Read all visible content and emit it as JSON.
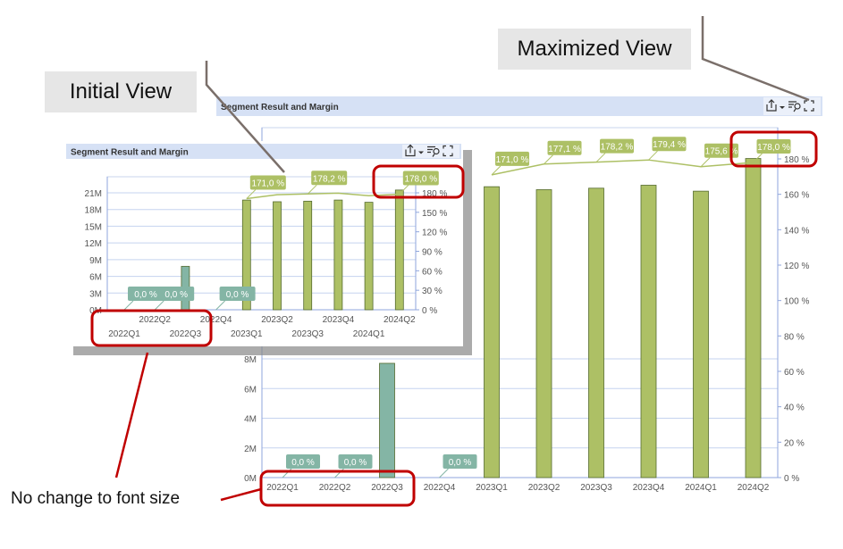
{
  "annotations": {
    "maximized_label": "Maximized View",
    "initial_label": "Initial View",
    "note": "No change to font size",
    "callout_color": "#e6e6e6",
    "highlight_color": "#c00000"
  },
  "panels": {
    "title": "Segment Result and Margin",
    "header_color": "#d6e1f5",
    "toolbar_icons": [
      "export-icon",
      "chevron-down-icon",
      "filter-search-icon",
      "maximize-icon"
    ],
    "maximized_toolbar_icons": [
      "export-icon",
      "chevron-down-icon",
      "filter-search-icon",
      "minimize-icon"
    ]
  },
  "chart_data": [
    {
      "name": "initial",
      "type": "bar",
      "title": "Segment Result and Margin",
      "categories": [
        "2022Q1",
        "2022Q2",
        "2022Q3",
        "2022Q4",
        "2023Q1",
        "2023Q2",
        "2023Q3",
        "2023Q4",
        "2024Q1",
        "2024Q2"
      ],
      "bar_values_M": [
        0,
        0,
        7.8,
        0,
        19.7,
        19.4,
        19.5,
        19.7,
        19.3,
        21.5
      ],
      "bar_colors": [
        "#84b5a5",
        "#84b5a5",
        "#84b5a5",
        "#84b5a5",
        "#adc065",
        "#adc065",
        "#adc065",
        "#adc065",
        "#adc065",
        "#adc065"
      ],
      "margin_pct": [
        0,
        0,
        null,
        0,
        171.0,
        177.1,
        178.2,
        179.4,
        175.6,
        178.0
      ],
      "margin_labels": [
        "0,0 %",
        "0,0 %",
        "",
        "0,0 %",
        "171,0 %",
        "",
        "178,2 %",
        "",
        "",
        "178,0 %"
      ],
      "left_ticks": [
        "0M",
        "3M",
        "6M",
        "9M",
        "12M",
        "15M",
        "18M",
        "21M"
      ],
      "left_range_M": [
        0,
        21
      ],
      "right_ticks": [
        "0 %",
        "30 %",
        "60 %",
        "90 %",
        "120 %",
        "150 %",
        "180 %"
      ],
      "right_range_pct": [
        0,
        180
      ],
      "grid": true
    },
    {
      "name": "maximized",
      "type": "bar",
      "title": "Segment Result and Margin",
      "categories": [
        "2022Q1",
        "2022Q2",
        "2022Q3",
        "2022Q4",
        "2023Q1",
        "2023Q2",
        "2023Q3",
        "2023Q4",
        "2024Q1",
        "2024Q2"
      ],
      "bar_values_M": [
        0,
        0,
        7.7,
        0,
        19.6,
        19.4,
        19.5,
        19.7,
        19.3,
        21.5
      ],
      "bar_colors": [
        "#84b5a5",
        "#84b5a5",
        "#84b5a5",
        "#84b5a5",
        "#adc065",
        "#adc065",
        "#adc065",
        "#adc065",
        "#adc065",
        "#adc065"
      ],
      "margin_pct": [
        0,
        0,
        null,
        0,
        171.0,
        177.1,
        178.2,
        179.4,
        175.6,
        178.0
      ],
      "margin_labels": [
        "0,0 %",
        "0,0 %",
        "",
        "0,0 %",
        "171,0 %",
        "177,1 %",
        "178,2 %",
        "179,4 %",
        "175,6 %",
        "178,0 %"
      ],
      "left_ticks": [
        "0M",
        "2M",
        "4M",
        "6M",
        "8M"
      ],
      "left_range_M": [
        0,
        8
      ],
      "right_ticks": [
        "0 %",
        "20 %",
        "40 %",
        "60 %",
        "80 %",
        "100 %",
        "120 %",
        "140 %",
        "160 %",
        "180 %"
      ],
      "right_range_pct": [
        0,
        180
      ],
      "grid": true
    }
  ]
}
